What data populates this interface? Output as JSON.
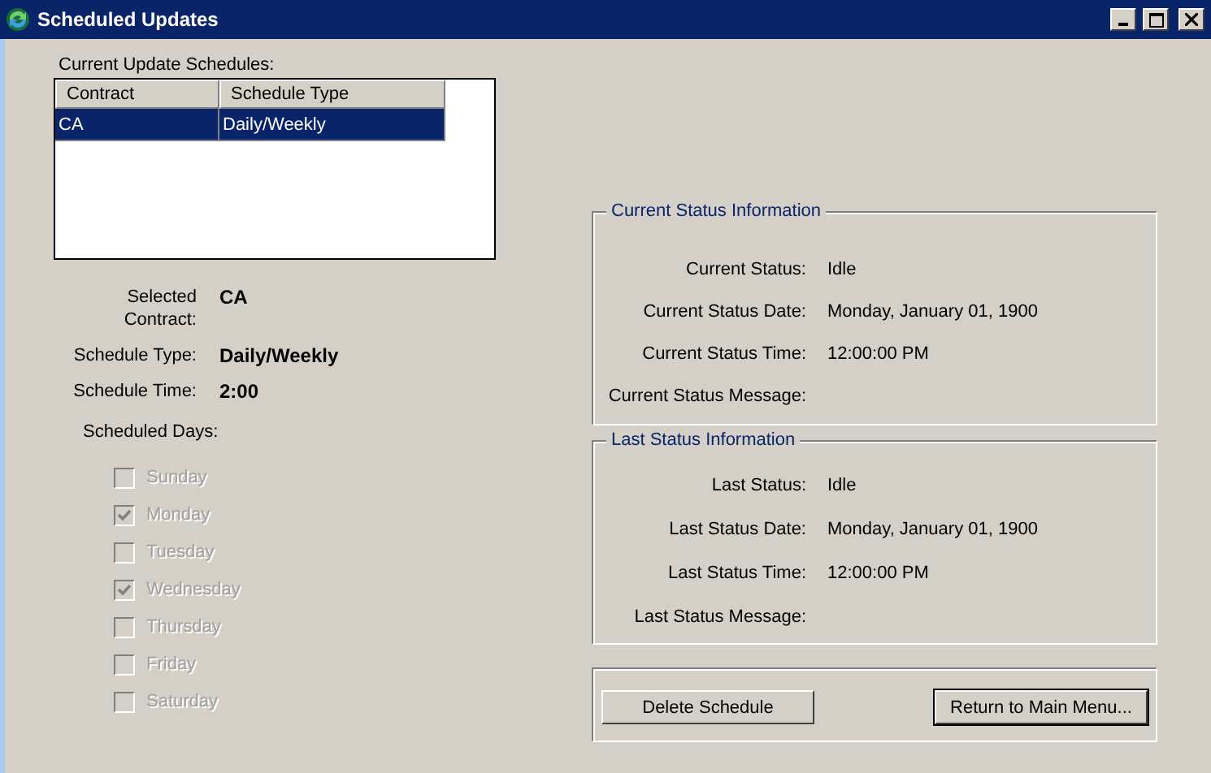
{
  "window": {
    "title": "Scheduled Updates"
  },
  "schedules": {
    "label": "Current Update Schedules:",
    "columns": [
      "Contract",
      "Schedule Type"
    ],
    "rows": [
      {
        "cells": [
          "CA",
          "Daily/Weekly"
        ],
        "selected": true
      }
    ]
  },
  "details": [
    {
      "label": "Selected Contract:",
      "value": "CA"
    },
    {
      "label": "Schedule Type:",
      "value": "Daily/Weekly"
    },
    {
      "label": "Schedule Time:",
      "value": "2:00"
    }
  ],
  "scheduled_days": {
    "label": "Scheduled Days:",
    "days": [
      {
        "label": "Sunday",
        "checked": false,
        "disabled": true
      },
      {
        "label": "Monday",
        "checked": true,
        "disabled": true
      },
      {
        "label": "Tuesday",
        "checked": false,
        "disabled": true
      },
      {
        "label": "Wednesday",
        "checked": true,
        "disabled": true
      },
      {
        "label": "Thursday",
        "checked": false,
        "disabled": true
      },
      {
        "label": "Friday",
        "checked": false,
        "disabled": true
      },
      {
        "label": "Saturday",
        "checked": false,
        "disabled": true
      }
    ]
  },
  "current_status": {
    "title": "Current Status Information",
    "fields": [
      {
        "label": "Current Status:",
        "value": "Idle"
      },
      {
        "label": "Current Status Date:",
        "value": "Monday, January 01, 1900"
      },
      {
        "label": "Current Status Time:",
        "value": "12:00:00 PM"
      },
      {
        "label": "Current Status Message:"
      }
    ]
  },
  "last_status": {
    "title": "Last Status Information",
    "fields": [
      {
        "label": "Last Status:",
        "value": "Idle"
      },
      {
        "label": "Last Status Date:",
        "value": "Monday, January 01, 1900"
      },
      {
        "label": "Last Status Time:",
        "value": "12:00:00 PM"
      },
      {
        "label": "Last Status Message:"
      }
    ]
  },
  "buttons": [
    {
      "label": "Delete Schedule",
      "default": false
    },
    {
      "label": "Return to Main Menu...",
      "default": true
    }
  ]
}
